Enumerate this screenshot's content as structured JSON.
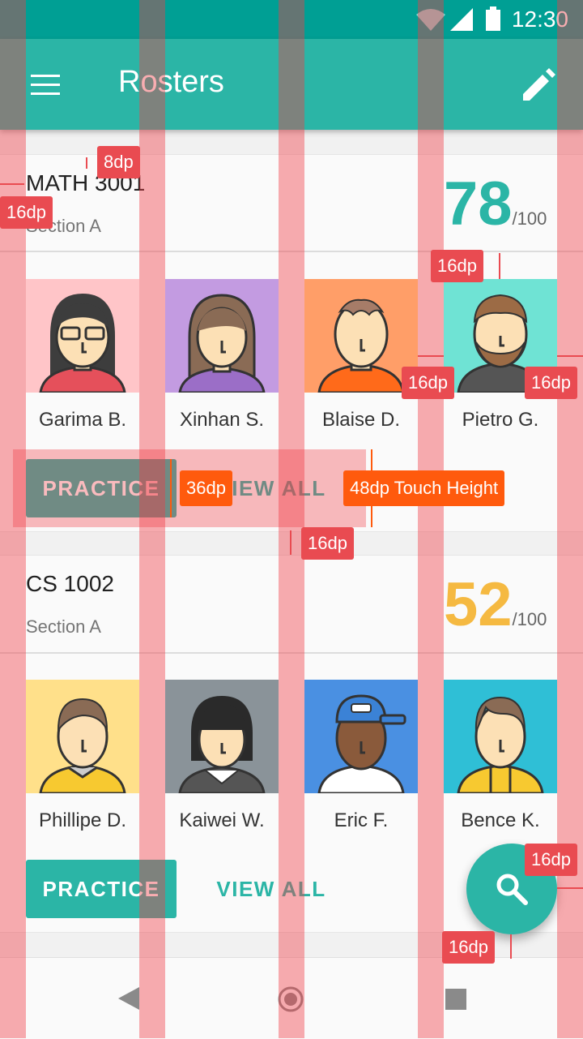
{
  "status": {
    "time": "12:30",
    "icons": [
      "wifi-icon",
      "signal-icon",
      "battery-icon"
    ]
  },
  "appbar": {
    "title": "Rosters",
    "menu_icon": "menu-icon",
    "edit_icon": "pencil-icon"
  },
  "rosters": [
    {
      "course": "MATH 3001",
      "section": "Section A",
      "score": "78",
      "out_of": "/100",
      "score_color": "#2bb5a6",
      "students": [
        {
          "name": "Garima B.",
          "bg": "#ffc5c8"
        },
        {
          "name": "Xinhan S.",
          "bg": "#c39be1"
        },
        {
          "name": "Blaise D.",
          "bg": "#ff9e68"
        },
        {
          "name": "Pietro G.",
          "bg": "#6fe3d4"
        }
      ],
      "practice_label": "PRACTICE",
      "view_all_label": "VIEW ALL"
    },
    {
      "course": "CS 1002",
      "section": "Section A",
      "score": "52",
      "out_of": "/100",
      "score_color": "#f5b941",
      "students": [
        {
          "name": "Phillipe D.",
          "bg": "#ffe08a"
        },
        {
          "name": "Kaiwei W.",
          "bg": "#8a9399"
        },
        {
          "name": "Eric F.",
          "bg": "#4a90e2"
        },
        {
          "name": "Bence K.",
          "bg": "#2fbfd6"
        }
      ],
      "practice_label": "PRACTICE",
      "view_all_label": "VIEW ALL"
    }
  ],
  "fab": {
    "icon": "search-icon"
  },
  "navbar": {
    "icons": [
      "back-icon",
      "home-icon",
      "recents-icon"
    ]
  },
  "annotations": {
    "a1": "8dp",
    "a2": "16dp",
    "a3": "16dp",
    "a4": "16dp",
    "a5": "16dp",
    "a6": "36dp",
    "a7": "48dp Touch Height",
    "a8": "16dp",
    "a9": "16dp",
    "a10": "16dp"
  },
  "colors": {
    "primary": "#2bb5a6",
    "primary_dark": "#009f94",
    "overlay_red": "#e94b51",
    "overlay_orange": "#ff5a0d"
  }
}
